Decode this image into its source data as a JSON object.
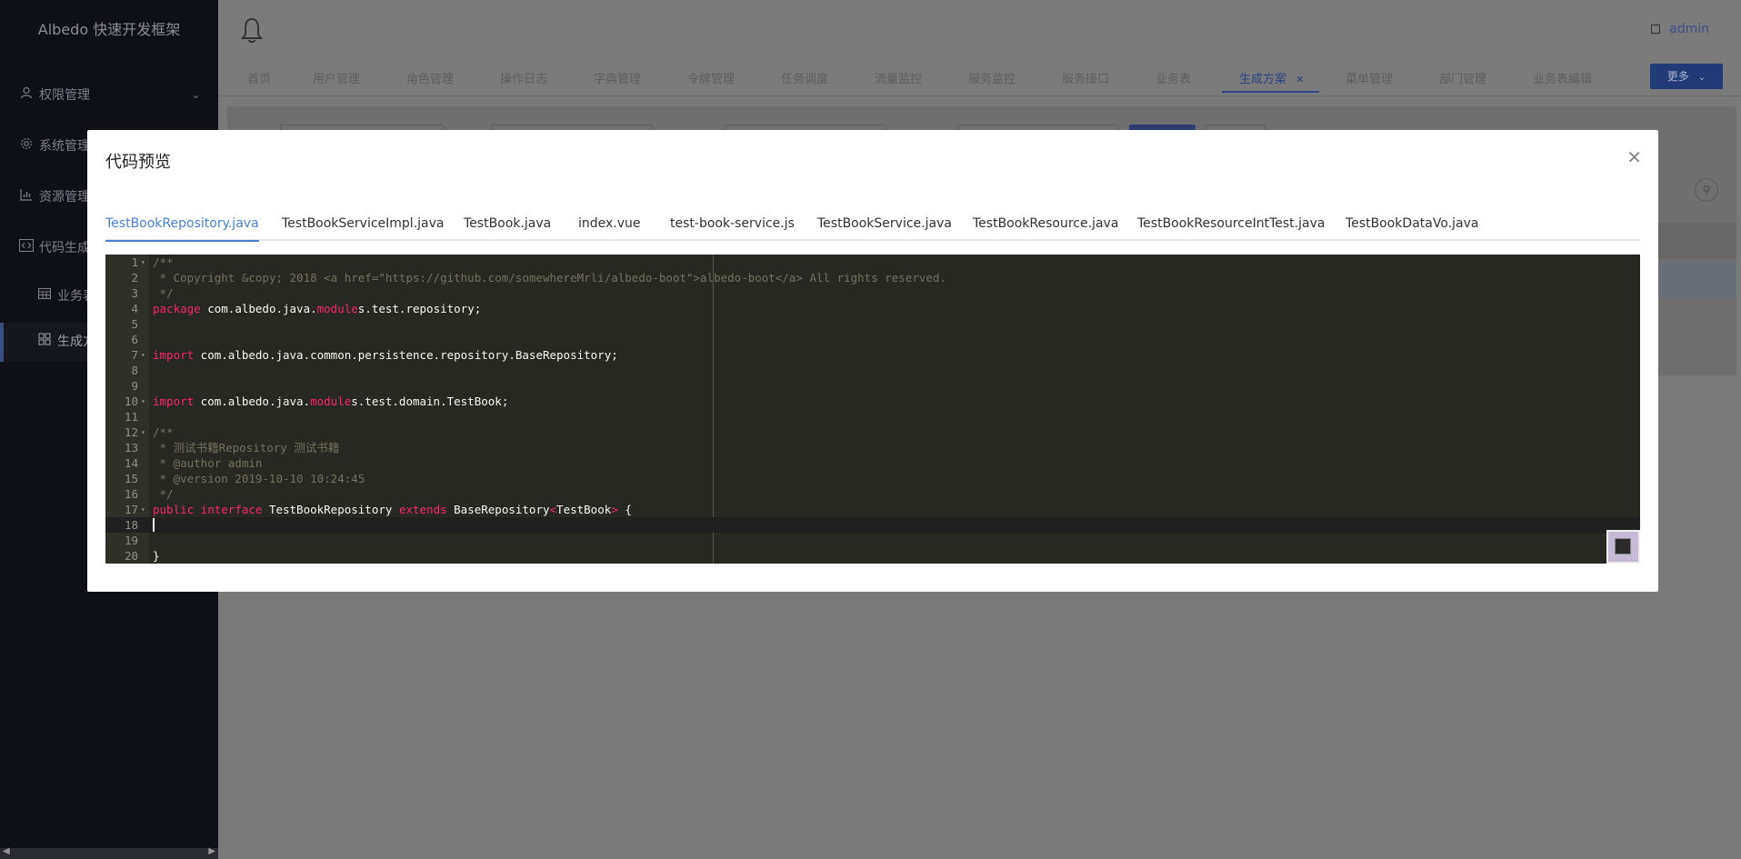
{
  "brand": "Albedo 快速开发框架",
  "sidebar": {
    "items": [
      {
        "label": "权限管理",
        "icon": "user-icon"
      },
      {
        "label": "系统管理",
        "icon": "gear-icon"
      },
      {
        "label": "资源管理",
        "icon": "bar-chart-icon"
      },
      {
        "label": "代码生成",
        "icon": "code-icon"
      },
      {
        "label": "业务表",
        "icon": "table-icon"
      },
      {
        "label": "生成方案",
        "icon": "grid-icon"
      }
    ]
  },
  "header": {
    "user": "admin"
  },
  "nav_tabs": [
    "首页",
    "用户管理",
    "角色管理",
    "操作日志",
    "字典管理",
    "令牌管理",
    "任务调度",
    "流量监控",
    "服务监控",
    "服务接口",
    "业务表",
    "生成方案",
    "菜单管理",
    "部门管理",
    "业务表编辑"
  ],
  "nav_active": "生成方案",
  "more_label": "更多",
  "modal": {
    "title": "代码预览",
    "tabs": [
      "TestBookRepository.java",
      "TestBookServiceImpl.java",
      "TestBook.java",
      "index.vue",
      "test-book-service.js",
      "TestBookService.java",
      "TestBookResource.java",
      "TestBookResourceIntTest.java",
      "TestBookDataVo.java"
    ],
    "active_tab": "TestBookRepository.java",
    "code_lines": [
      "/**",
      " * Copyright &copy; 2018 <a href=\"https://github.com/somewhereMrli/albedo-boot\">albedo-boot</a> All rights reserved.",
      " */",
      "package com.albedo.java.modules.test.repository;",
      "",
      "",
      "import com.albedo.java.common.persistence.repository.BaseRepository;",
      "",
      "",
      "import com.albedo.java.modules.test.domain.TestBook;",
      "",
      "/**",
      " * 测试书籍Repository 测试书籍",
      " * @author admin",
      " * @version 2019-10-10 10:24:45",
      " */",
      "public interface TestBookRepository extends BaseRepository<TestBook> {",
      "",
      "",
      "}"
    ]
  }
}
